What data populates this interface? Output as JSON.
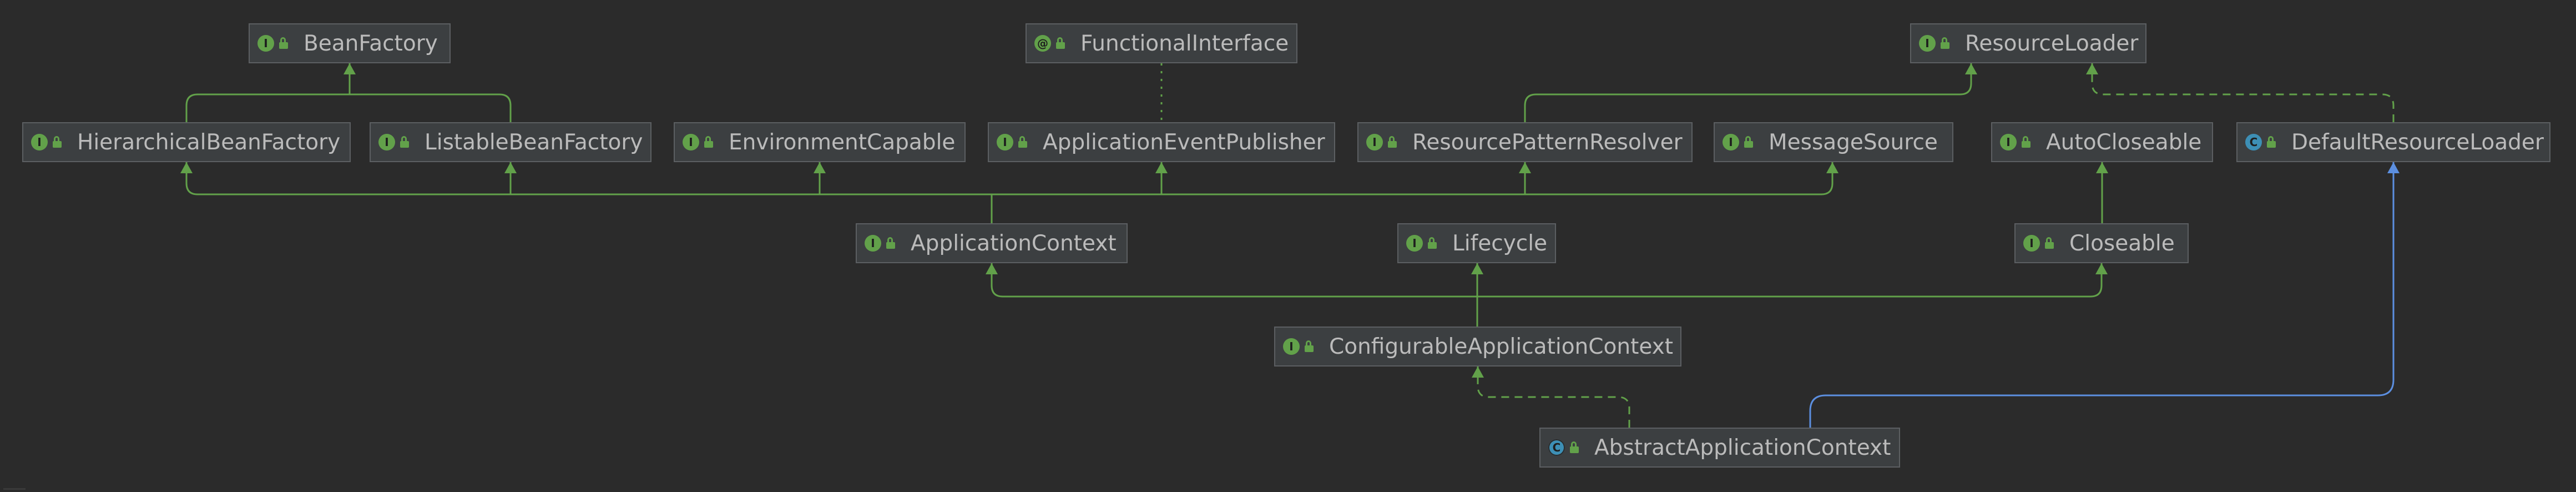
{
  "diagram": {
    "colors": {
      "background": "#2b2b2b",
      "node_fill": "#3c3f41",
      "node_border": "#5c5f62",
      "text": "#bbbbbb",
      "extends_edge": "#62a14a",
      "implements_edge": "#62a14a",
      "class_extends_edge": "#5c8fe0",
      "interface_badge": "#62a14a",
      "class_badge": "#3d8fb5"
    },
    "nodes": [
      {
        "id": "bean-factory",
        "label": "BeanFactory",
        "kind": "interface",
        "badge_icon": "interface-icon",
        "access_icon": "public-lock-icon"
      },
      {
        "id": "functional-interface",
        "label": "FunctionalInterface",
        "kind": "annotation",
        "badge_icon": "annotation-icon",
        "access_icon": "public-lock-icon"
      },
      {
        "id": "resource-loader",
        "label": "ResourceLoader",
        "kind": "interface",
        "badge_icon": "interface-icon",
        "access_icon": "public-lock-icon"
      },
      {
        "id": "hierarchical-bean-factory",
        "label": "HierarchicalBeanFactory",
        "kind": "interface",
        "badge_icon": "interface-icon",
        "access_icon": "public-lock-icon"
      },
      {
        "id": "listable-bean-factory",
        "label": "ListableBeanFactory",
        "kind": "interface",
        "badge_icon": "interface-icon",
        "access_icon": "public-lock-icon"
      },
      {
        "id": "environment-capable",
        "label": "EnvironmentCapable",
        "kind": "interface",
        "badge_icon": "interface-icon",
        "access_icon": "public-lock-icon"
      },
      {
        "id": "application-event-publisher",
        "label": "ApplicationEventPublisher",
        "kind": "interface",
        "badge_icon": "interface-icon",
        "access_icon": "public-lock-icon"
      },
      {
        "id": "resource-pattern-resolver",
        "label": "ResourcePatternResolver",
        "kind": "interface",
        "badge_icon": "interface-icon",
        "access_icon": "public-lock-icon"
      },
      {
        "id": "message-source",
        "label": "MessageSource",
        "kind": "interface",
        "badge_icon": "interface-icon",
        "access_icon": "public-lock-icon"
      },
      {
        "id": "auto-closeable",
        "label": "AutoCloseable",
        "kind": "interface",
        "badge_icon": "interface-icon",
        "access_icon": "public-lock-icon"
      },
      {
        "id": "default-resource-loader",
        "label": "DefaultResourceLoader",
        "kind": "class",
        "badge_icon": "class-icon",
        "access_icon": "public-lock-icon"
      },
      {
        "id": "application-context",
        "label": "ApplicationContext",
        "kind": "interface",
        "badge_icon": "interface-icon",
        "access_icon": "public-lock-icon"
      },
      {
        "id": "lifecycle",
        "label": "Lifecycle",
        "kind": "interface",
        "badge_icon": "interface-icon",
        "access_icon": "public-lock-icon"
      },
      {
        "id": "closeable",
        "label": "Closeable",
        "kind": "interface",
        "badge_icon": "interface-icon",
        "access_icon": "public-lock-icon"
      },
      {
        "id": "configurable-application-context",
        "label": "ConfigurableApplicationContext",
        "kind": "interface",
        "badge_icon": "interface-icon",
        "access_icon": "public-lock-icon"
      },
      {
        "id": "abstract-application-context",
        "label": "AbstractApplicationContext",
        "kind": "abstract-class",
        "badge_icon": "abstract-class-icon",
        "access_icon": "public-lock-icon"
      }
    ],
    "edges": [
      {
        "from": "hierarchical-bean-factory",
        "to": "bean-factory",
        "type": "extends"
      },
      {
        "from": "listable-bean-factory",
        "to": "bean-factory",
        "type": "extends"
      },
      {
        "from": "application-event-publisher",
        "to": "functional-interface",
        "type": "annotated"
      },
      {
        "from": "resource-pattern-resolver",
        "to": "resource-loader",
        "type": "extends"
      },
      {
        "from": "default-resource-loader",
        "to": "resource-loader",
        "type": "implements"
      },
      {
        "from": "application-context",
        "to": "hierarchical-bean-factory",
        "type": "extends"
      },
      {
        "from": "application-context",
        "to": "listable-bean-factory",
        "type": "extends"
      },
      {
        "from": "application-context",
        "to": "environment-capable",
        "type": "extends"
      },
      {
        "from": "application-context",
        "to": "application-event-publisher",
        "type": "extends"
      },
      {
        "from": "application-context",
        "to": "resource-pattern-resolver",
        "type": "extends"
      },
      {
        "from": "application-context",
        "to": "message-source",
        "type": "extends"
      },
      {
        "from": "closeable",
        "to": "auto-closeable",
        "type": "extends"
      },
      {
        "from": "configurable-application-context",
        "to": "application-context",
        "type": "extends"
      },
      {
        "from": "configurable-application-context",
        "to": "lifecycle",
        "type": "extends"
      },
      {
        "from": "configurable-application-context",
        "to": "closeable",
        "type": "extends"
      },
      {
        "from": "abstract-application-context",
        "to": "configurable-application-context",
        "type": "implements"
      },
      {
        "from": "abstract-application-context",
        "to": "default-resource-loader",
        "type": "class-extends"
      }
    ]
  }
}
